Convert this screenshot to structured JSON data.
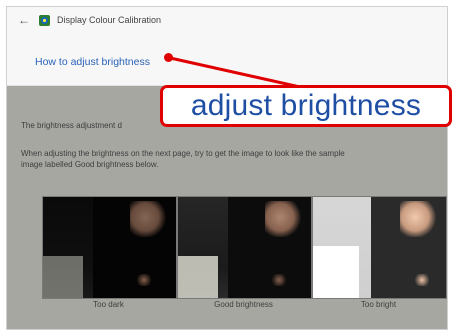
{
  "window": {
    "back_icon": "arrow-left-icon",
    "app_icon": "display-calibration-icon",
    "title": "Display Colour Calibration"
  },
  "header": {
    "link_text": "How to adjust brightness"
  },
  "content": {
    "paragraph1": "The brightness adjustment d",
    "paragraph2_line1": "When adjusting the brightness on the next page, try to get the image to look like the sample",
    "paragraph2_line2": "image labelled Good brightness below."
  },
  "samples": [
    {
      "label": "Too dark"
    },
    {
      "label": "Good brightness"
    },
    {
      "label": "Too bright"
    }
  ],
  "callout": {
    "text": "adjust brightness",
    "color": "#e00000"
  }
}
